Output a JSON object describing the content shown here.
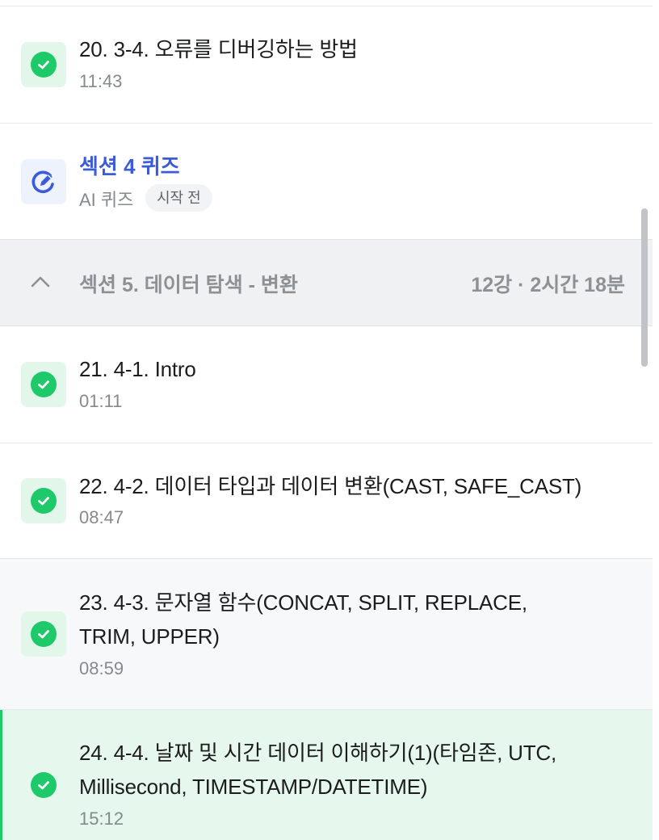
{
  "lectures": [
    {
      "title": "20. 3-4. 오류를 디버깅하는 방법",
      "duration": "11:43"
    },
    {
      "title": "21. 4-1. Intro",
      "duration": "01:11"
    },
    {
      "title": "22. 4-2. 데이터 타입과 데이터 변환(CAST, SAFE_CAST)",
      "duration": "08:47"
    },
    {
      "title_line1": "23. 4-3. 문자열 함수(CONCAT, SPLIT, REPLACE,",
      "title_line2": "TRIM, UPPER)",
      "duration": "08:59"
    },
    {
      "title_line1": "24. 4-4. 날짜 및 시간 데이터 이해하기(1)(타임존, UTC,",
      "title_line2": "Millisecond, TIMESTAMP/DATETIME)",
      "duration": "15:12"
    }
  ],
  "quiz": {
    "title": "섹션 4 퀴즈",
    "subtitle": "AI 퀴즈",
    "status": "시작 전"
  },
  "section": {
    "title": "섹션 5. 데이터 탐색 - 변환",
    "meta": "12강 · 2시간 18분"
  },
  "colors": {
    "accent_green": "#1ec96a",
    "quiz_blue": "#3b5bdb",
    "active_bg": "#e6f7ee"
  },
  "icons": {
    "check": "check-circle-icon",
    "quiz": "pencil-circle-icon",
    "collapse": "chevron-up-icon"
  }
}
